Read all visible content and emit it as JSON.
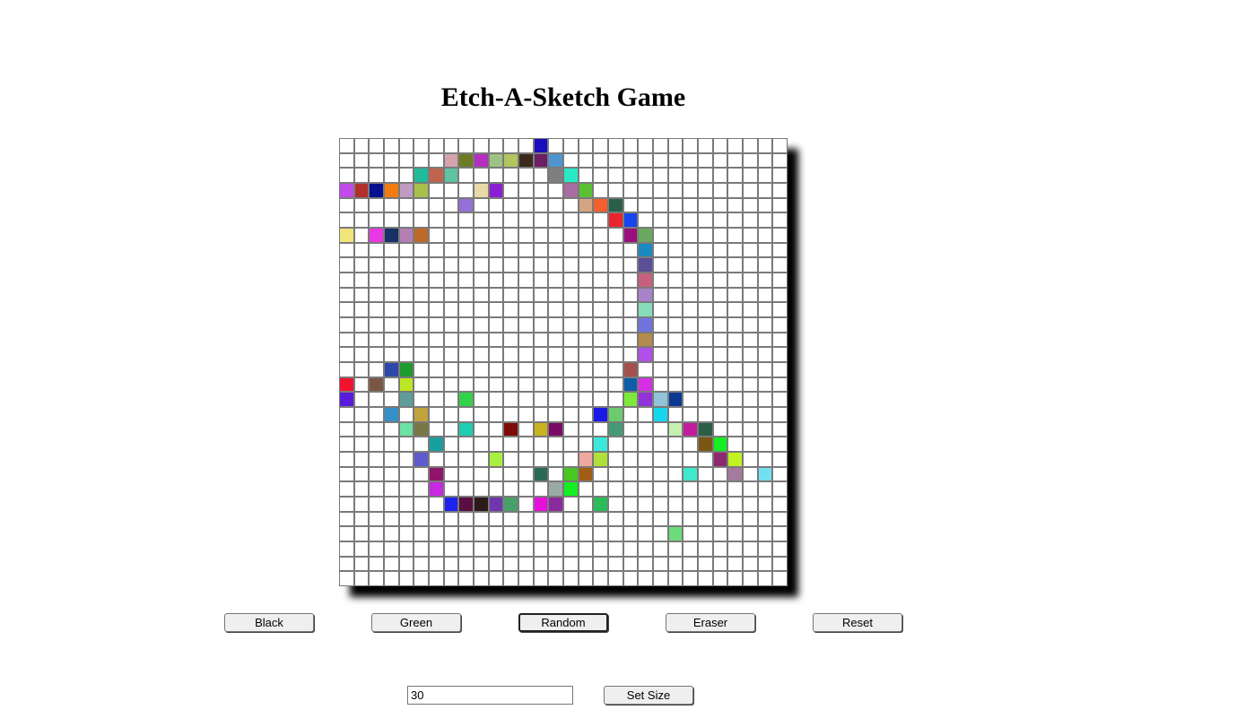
{
  "title": "Etch-A-Sketch Game",
  "buttons": {
    "black": "Black",
    "green": "Green",
    "random": "Random",
    "eraser": "Eraser",
    "reset": "Reset",
    "set_size": "Set Size"
  },
  "active_mode": "random",
  "size_input": {
    "value": "30"
  },
  "grid": {
    "size": 30,
    "background": "#ffffff",
    "border_color": "#7a7a7a",
    "painted": [
      [
        0,
        13,
        "#1a0dbf"
      ],
      [
        1,
        7,
        "#d4a3ad"
      ],
      [
        1,
        8,
        "#6f7b25"
      ],
      [
        1,
        9,
        "#b42ec0"
      ],
      [
        1,
        10,
        "#9ec283"
      ],
      [
        1,
        11,
        "#b3c55d"
      ],
      [
        1,
        12,
        "#3b2a1c"
      ],
      [
        1,
        13,
        "#6b1f64"
      ],
      [
        1,
        14,
        "#4f95d1"
      ],
      [
        2,
        5,
        "#1fbc99"
      ],
      [
        2,
        6,
        "#c0644f"
      ],
      [
        2,
        7,
        "#5fc3a0"
      ],
      [
        2,
        14,
        "#7f7f7f"
      ],
      [
        2,
        15,
        "#27e9c3"
      ],
      [
        3,
        0,
        "#c24ae8"
      ],
      [
        3,
        1,
        "#b3302a"
      ],
      [
        3,
        2,
        "#09108f"
      ],
      [
        3,
        3,
        "#f37b10"
      ],
      [
        3,
        4,
        "#c09bc2"
      ],
      [
        3,
        5,
        "#a7c04a"
      ],
      [
        3,
        9,
        "#ead9a8"
      ],
      [
        3,
        10,
        "#8a1fd3"
      ],
      [
        3,
        15,
        "#a86da0"
      ],
      [
        3,
        16,
        "#5dc034"
      ],
      [
        4,
        8,
        "#9470d9"
      ],
      [
        4,
        16,
        "#d5a583"
      ],
      [
        4,
        17,
        "#f35f2d"
      ],
      [
        4,
        18,
        "#2a6049"
      ],
      [
        5,
        18,
        "#e9242c"
      ],
      [
        5,
        19,
        "#1645f2"
      ],
      [
        6,
        0,
        "#f0e47a"
      ],
      [
        6,
        2,
        "#e937e4"
      ],
      [
        6,
        3,
        "#173066"
      ],
      [
        6,
        4,
        "#b47fb2"
      ],
      [
        6,
        5,
        "#bd6a28"
      ],
      [
        6,
        19,
        "#9a0f7b"
      ],
      [
        6,
        20,
        "#6aa85f"
      ],
      [
        7,
        20,
        "#1a8ac0"
      ],
      [
        8,
        20,
        "#5b4f97"
      ],
      [
        9,
        20,
        "#c7607e"
      ],
      [
        10,
        20,
        "#a784c9"
      ],
      [
        11,
        20,
        "#87dcb9"
      ],
      [
        12,
        20,
        "#7173df"
      ],
      [
        13,
        20,
        "#b38b4c"
      ],
      [
        14,
        20,
        "#b24ee9"
      ],
      [
        15,
        3,
        "#2e47a8"
      ],
      [
        15,
        4,
        "#1f9b2f"
      ],
      [
        15,
        19,
        "#a3504e"
      ],
      [
        16,
        0,
        "#f2132f"
      ],
      [
        16,
        2,
        "#7b5643"
      ],
      [
        16,
        4,
        "#bde722"
      ],
      [
        16,
        19,
        "#105ca8"
      ],
      [
        16,
        20,
        "#d42fe5"
      ],
      [
        17,
        0,
        "#5a1ad9"
      ],
      [
        17,
        4,
        "#5f9c9c"
      ],
      [
        17,
        8,
        "#33d24b"
      ],
      [
        17,
        19,
        "#7ee93a"
      ],
      [
        17,
        20,
        "#9133d9"
      ],
      [
        17,
        21,
        "#8fc4d9"
      ],
      [
        17,
        22,
        "#0c3896"
      ],
      [
        18,
        3,
        "#3590c7"
      ],
      [
        18,
        5,
        "#c2a23a"
      ],
      [
        18,
        17,
        "#1a1ae6"
      ],
      [
        18,
        18,
        "#6ccb6c"
      ],
      [
        18,
        21,
        "#14d7ee"
      ],
      [
        19,
        4,
        "#6de2a5"
      ],
      [
        19,
        5,
        "#787846"
      ],
      [
        19,
        8,
        "#1fcdb0"
      ],
      [
        19,
        11,
        "#7e0a0a"
      ],
      [
        19,
        13,
        "#c8b21d"
      ],
      [
        19,
        14,
        "#7a0a66"
      ],
      [
        19,
        18,
        "#459a73"
      ],
      [
        19,
        22,
        "#c5f0b0"
      ],
      [
        19,
        23,
        "#c21c9d"
      ],
      [
        19,
        24,
        "#2b5f45"
      ],
      [
        20,
        6,
        "#1a9fa0"
      ],
      [
        20,
        17,
        "#3ae9da"
      ],
      [
        20,
        24,
        "#7a5713"
      ],
      [
        20,
        25,
        "#15ee20"
      ],
      [
        21,
        5,
        "#5f5bcc"
      ],
      [
        21,
        10,
        "#a8ef3f"
      ],
      [
        21,
        16,
        "#f0a8a2"
      ],
      [
        21,
        17,
        "#aedf3a"
      ],
      [
        21,
        25,
        "#8b2b6d"
      ],
      [
        21,
        26,
        "#c2f222"
      ],
      [
        22,
        6,
        "#8e1569"
      ],
      [
        22,
        13,
        "#2a6a56"
      ],
      [
        22,
        15,
        "#4ac622"
      ],
      [
        22,
        16,
        "#a05d14"
      ],
      [
        22,
        23,
        "#3ee9cc"
      ],
      [
        22,
        26,
        "#a57a9f"
      ],
      [
        22,
        28,
        "#72e0f0"
      ],
      [
        23,
        6,
        "#c729e0"
      ],
      [
        23,
        14,
        "#9aaaa6"
      ],
      [
        23,
        15,
        "#14ee23"
      ],
      [
        24,
        7,
        "#1e22ee"
      ],
      [
        24,
        8,
        "#5a0f40"
      ],
      [
        24,
        9,
        "#2b1a1a"
      ],
      [
        24,
        10,
        "#6f36ad"
      ],
      [
        24,
        11,
        "#47a06a"
      ],
      [
        24,
        13,
        "#e60fdd"
      ],
      [
        24,
        14,
        "#8a2a9c"
      ],
      [
        24,
        17,
        "#2bbc5a"
      ],
      [
        26,
        22,
        "#6cdc7a"
      ]
    ]
  }
}
